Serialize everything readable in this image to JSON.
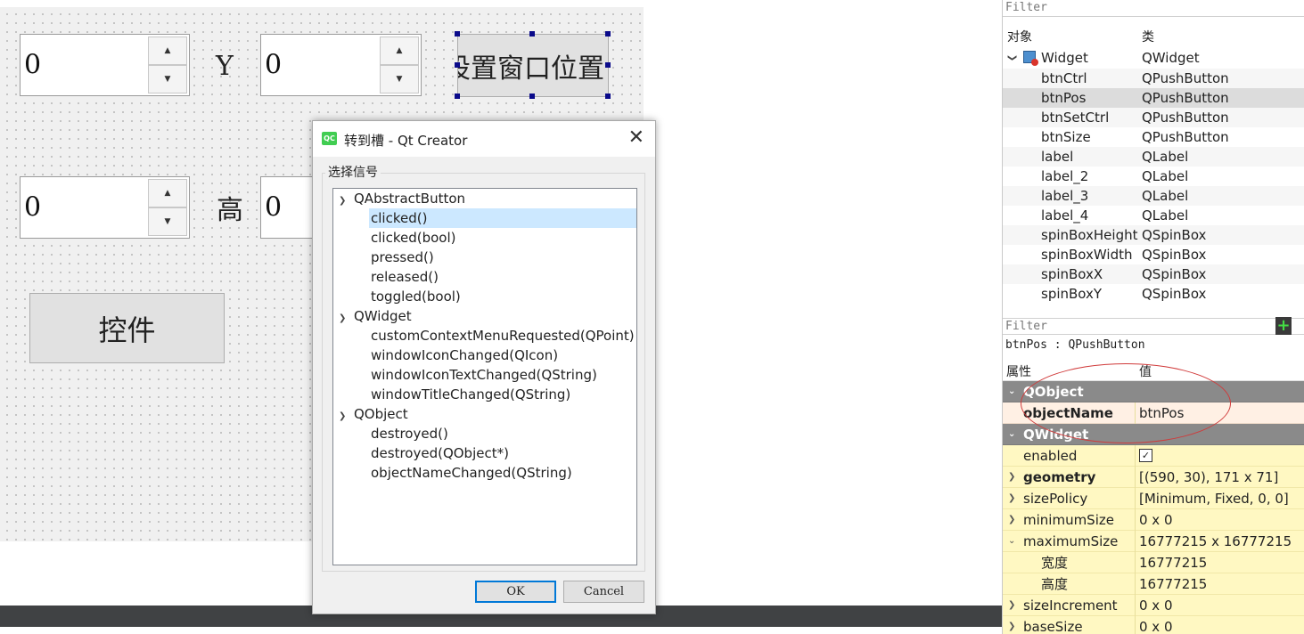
{
  "canvas": {
    "spin_x": {
      "value": "0"
    },
    "label_y": "Y",
    "spin_y": {
      "value": "0"
    },
    "btn_pos": "设置窗口位置",
    "spin_width": {
      "value": "0"
    },
    "label_height": "高",
    "spin_height": {
      "value": "0"
    },
    "btn_ctrl": "控件",
    "spin_up_glyph": "▲",
    "spin_down_glyph": "▼"
  },
  "dialog": {
    "app_icon": "QC",
    "title": "转到槽 - Qt Creator",
    "close_glyph": "✕",
    "group_label": "选择信号",
    "groups": [
      {
        "name": "QAbstractButton",
        "signals": [
          "clicked()",
          "clicked(bool)",
          "pressed()",
          "released()",
          "toggled(bool)"
        ]
      },
      {
        "name": "QWidget",
        "signals": [
          "customContextMenuRequested(QPoint)",
          "windowIconChanged(QIcon)",
          "windowIconTextChanged(QString)",
          "windowTitleChanged(QString)"
        ]
      },
      {
        "name": "QObject",
        "signals": [
          "destroyed()",
          "destroyed(QObject*)",
          "objectNameChanged(QString)"
        ]
      }
    ],
    "selected_signal": "clicked()",
    "ok_label": "OK",
    "cancel_label": "Cancel"
  },
  "object_inspector": {
    "filter_placeholder": "Filter",
    "col_object": "对象",
    "col_class": "类",
    "root": {
      "name": "Widget",
      "class": "QWidget"
    },
    "rows": [
      {
        "name": "btnCtrl",
        "class": "QPushButton"
      },
      {
        "name": "btnPos",
        "class": "QPushButton"
      },
      {
        "name": "btnSetCtrl",
        "class": "QPushButton"
      },
      {
        "name": "btnSize",
        "class": "QPushButton"
      },
      {
        "name": "label",
        "class": "QLabel"
      },
      {
        "name": "label_2",
        "class": "QLabel"
      },
      {
        "name": "label_3",
        "class": "QLabel"
      },
      {
        "name": "label_4",
        "class": "QLabel"
      },
      {
        "name": "spinBoxHeight",
        "class": "QSpinBox"
      },
      {
        "name": "spinBoxWidth",
        "class": "QSpinBox"
      },
      {
        "name": "spinBoxX",
        "class": "QSpinBox"
      },
      {
        "name": "spinBoxY",
        "class": "QSpinBox"
      }
    ],
    "selected": "btnPos"
  },
  "property_editor": {
    "filter_placeholder": "Filter",
    "add_glyph": "+",
    "selection_info": "btnPos : QPushButton",
    "col_property": "属性",
    "col_value": "值",
    "rows": [
      {
        "type": "section",
        "name": "QObject"
      },
      {
        "type": "prop",
        "name": "objectName",
        "value": "btnPos",
        "bold": true,
        "highlight": true
      },
      {
        "type": "section",
        "name": "QWidget"
      },
      {
        "type": "check",
        "name": "enabled",
        "checked": true
      },
      {
        "type": "prop",
        "name": "geometry",
        "value": "[(590, 30), 171 x 71]",
        "bold": true,
        "expandable": true
      },
      {
        "type": "prop",
        "name": "sizePolicy",
        "value": "[Minimum, Fixed, 0, 0]",
        "expandable": true
      },
      {
        "type": "prop",
        "name": "minimumSize",
        "value": "0 x 0",
        "expandable": true
      },
      {
        "type": "prop",
        "name": "maximumSize",
        "value": "16777215 x 16777215",
        "expanded": true
      },
      {
        "type": "sub",
        "name": "宽度",
        "value": "16777215"
      },
      {
        "type": "sub",
        "name": "高度",
        "value": "16777215"
      },
      {
        "type": "prop",
        "name": "sizeIncrement",
        "value": "0 x 0",
        "expandable": true
      },
      {
        "type": "prop",
        "name": "baseSize",
        "value": "0 x 0",
        "expandable": true
      }
    ]
  }
}
